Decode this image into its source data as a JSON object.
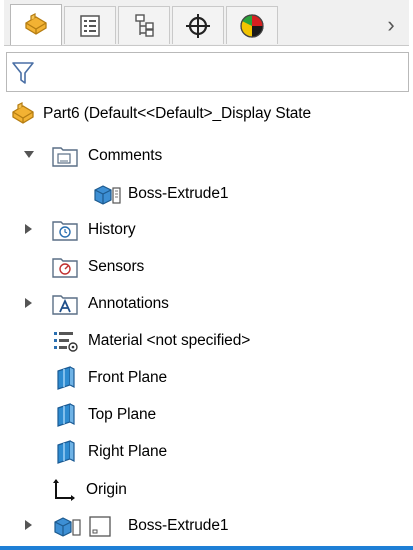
{
  "tabs": [
    {
      "name": "featuremanager-tab",
      "icon": "part-icon",
      "active": true
    },
    {
      "name": "propertymanager-tab",
      "icon": "property-list-icon",
      "active": false
    },
    {
      "name": "configurationmanager-tab",
      "icon": "configuration-icon",
      "active": false
    },
    {
      "name": "dimxpert-tab",
      "icon": "crosshair-icon",
      "active": false
    },
    {
      "name": "display-manager-tab",
      "icon": "appearance-pie-icon",
      "active": false
    }
  ],
  "tabs_more": "›",
  "filter": {
    "icon": "filter-funnel-icon",
    "value": ""
  },
  "tree": {
    "root_label": "Part6  (Default<<Default>_Display State",
    "items": [
      {
        "label": "Comments",
        "icon": "comments-folder-icon"
      },
      {
        "label": "Boss-Extrude1",
        "icon": "boss-extrude-icon"
      },
      {
        "label": "History",
        "icon": "history-folder-icon"
      },
      {
        "label": "Sensors",
        "icon": "sensors-folder-icon"
      },
      {
        "label": "Annotations",
        "icon": "annotations-folder-icon"
      },
      {
        "label": "Material <not specified>",
        "icon": "material-icon"
      },
      {
        "label": "Front Plane",
        "icon": "plane-icon"
      },
      {
        "label": "Top Plane",
        "icon": "plane-icon"
      },
      {
        "label": "Right Plane",
        "icon": "plane-icon"
      },
      {
        "label": "Origin",
        "icon": "origin-icon"
      },
      {
        "label": "Boss-Extrude1",
        "icon": "boss-extrude-icon"
      }
    ]
  },
  "colors": {
    "accent": "#1e7fd6",
    "part_orange": "#f2b233",
    "plane_blue": "#2e8bd0",
    "folder_outline": "#5a6f86"
  }
}
